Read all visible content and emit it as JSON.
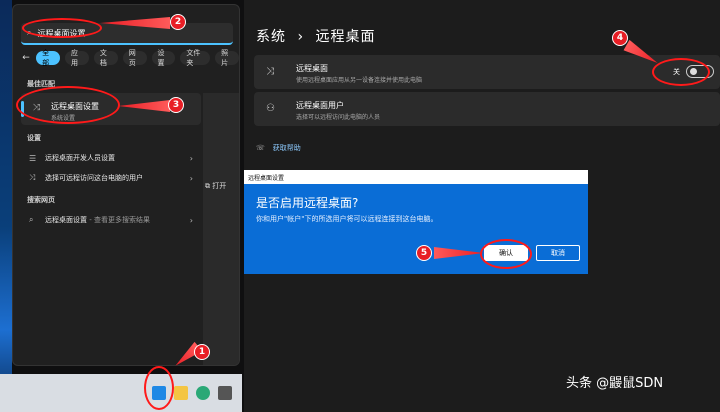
{
  "search_panel": {
    "query": "远程桌面设置",
    "filters": [
      "全部",
      "应用",
      "文档",
      "网页",
      "设置",
      "文件夹",
      "照片"
    ],
    "best_match_header": "最佳匹配",
    "best_match": {
      "title": "远程桌面设置",
      "subtitle": "系统设置"
    },
    "settings_header": "设置",
    "settings_items": [
      "远程桌面开发人员设置",
      "选择可远程访问这台电脑的用户"
    ],
    "web_header": "搜索网页",
    "web_item": {
      "label": "远程桌面设置",
      "suffix": " - 查看更多搜索结果"
    },
    "preview_open": "打开"
  },
  "settings": {
    "breadcrumb_parent": "系统",
    "breadcrumb_sep": "›",
    "page_title": "远程桌面",
    "remote_desktop": {
      "title": "远程桌面",
      "subtitle": "使用远程桌面应用从另一设备连接并使用此电脑",
      "toggle_label": "关",
      "toggle_on": false
    },
    "remote_users": {
      "title": "远程桌面用户",
      "subtitle": "选择可以远程访问此电脑的人员"
    },
    "help_link": "获取帮助"
  },
  "dialog": {
    "title": "远程桌面设置",
    "heading": "是否启用远程桌面?",
    "description": "你和用户\"帐户\"下的所选用户将可以远程连接到这台电脑。",
    "confirm_label": "确认",
    "cancel_label": "取消"
  },
  "annotations": [
    "1",
    "2",
    "3",
    "4",
    "5"
  ],
  "watermark": "头条 @鼹鼠SDN",
  "colors": {
    "accent": "#4cc2ff",
    "dialog_bg": "#0a6dd6",
    "annotation": "#e81e25"
  }
}
